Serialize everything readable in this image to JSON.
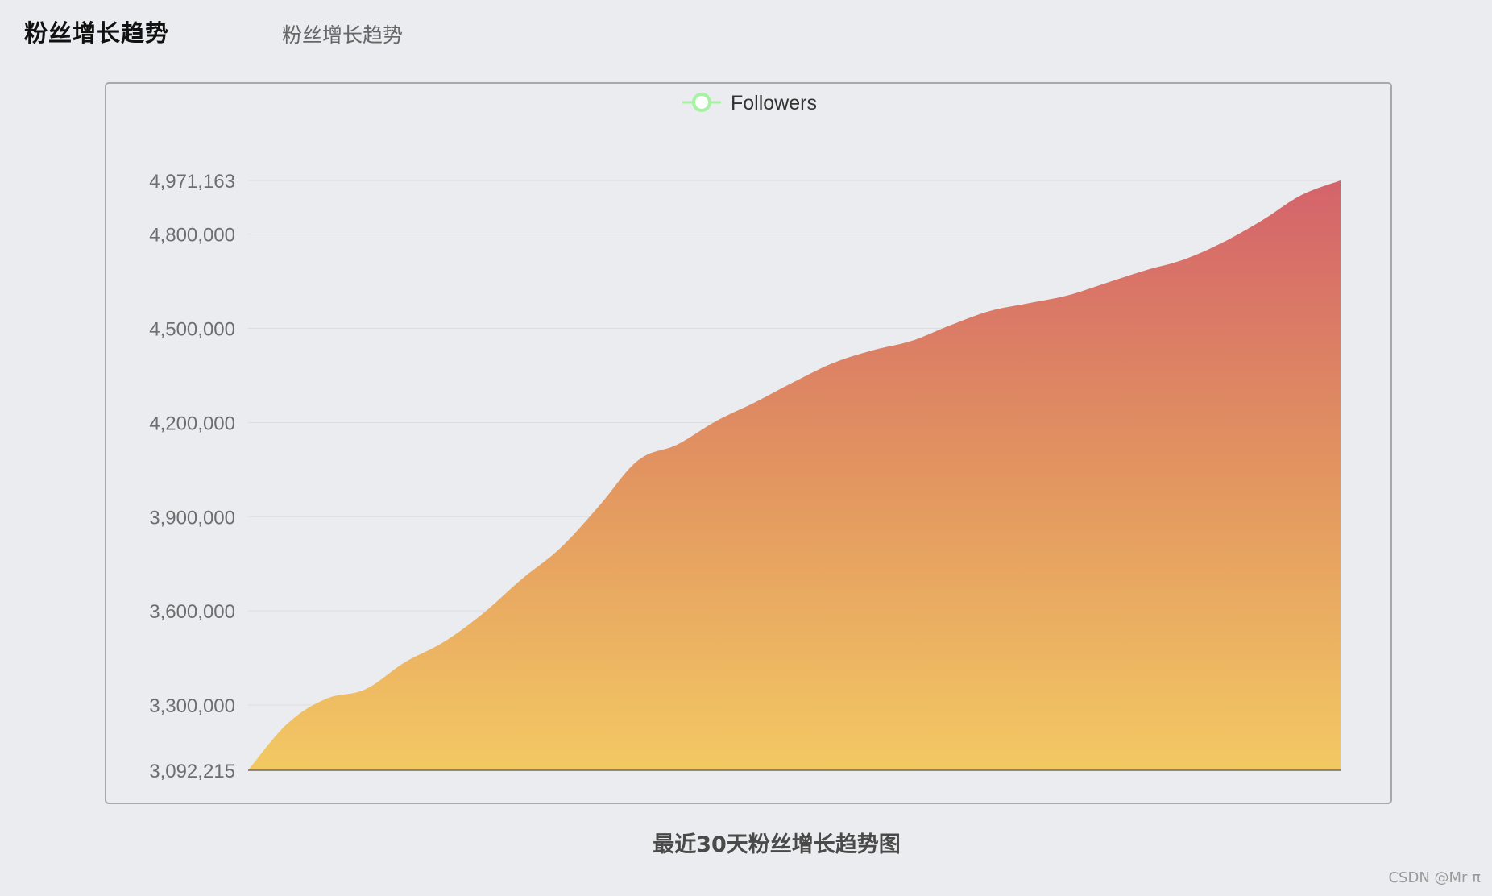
{
  "header": {
    "title": "粉丝增长趋势",
    "subtitle": "粉丝增长趋势"
  },
  "caption": "最近30天粉丝增长趋势图",
  "watermark": "CSDN @Mr π",
  "colors": {
    "area_top": "#d4636b",
    "area_mid": "#e29560",
    "area_bottom": "#f3c963",
    "legend_marker": "#a6f2a2",
    "background": "#ebecef",
    "frame_border": "#a7a8ab"
  },
  "chart_data": {
    "type": "area",
    "legend": [
      "Followers"
    ],
    "legend_position": "top-center",
    "grid": true,
    "ylim": [
      3092215,
      4971163
    ],
    "y_ticks": [
      "3,092,215",
      "3,300,000",
      "3,600,000",
      "3,900,000",
      "4,200,000",
      "4,500,000",
      "4,800,000",
      "4,971,163"
    ],
    "y_tick_values": [
      3092215,
      3300000,
      3600000,
      3900000,
      4200000,
      4500000,
      4800000,
      4971163
    ],
    "series": [
      {
        "name": "Followers",
        "values": [
          3092215,
          3240000,
          3320000,
          3350000,
          3435000,
          3500000,
          3590000,
          3700000,
          3800000,
          3935000,
          4080000,
          4130000,
          4205000,
          4265000,
          4330000,
          4390000,
          4430000,
          4460000,
          4510000,
          4555000,
          4580000,
          4605000,
          4645000,
          4685000,
          4720000,
          4775000,
          4845000,
          4925000,
          4971163
        ]
      }
    ]
  }
}
